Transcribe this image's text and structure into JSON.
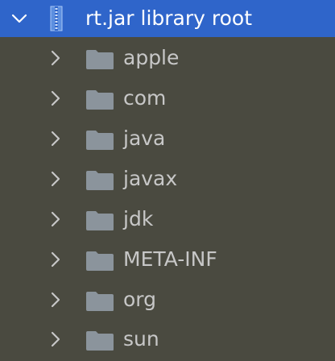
{
  "tree": {
    "root": {
      "label": "rt.jar  library root",
      "icon": "jar-archive-icon",
      "expanded": true
    },
    "children": [
      {
        "label": "apple",
        "icon": "folder-icon"
      },
      {
        "label": "com",
        "icon": "folder-icon"
      },
      {
        "label": "java",
        "icon": "folder-icon"
      },
      {
        "label": "javax",
        "icon": "folder-icon"
      },
      {
        "label": "jdk",
        "icon": "folder-icon"
      },
      {
        "label": "META-INF",
        "icon": "folder-icon"
      },
      {
        "label": "org",
        "icon": "folder-icon"
      },
      {
        "label": "sun",
        "icon": "folder-icon"
      }
    ]
  },
  "colors": {
    "background": "#4a4a40",
    "selection": "#2f65ca",
    "text": "#c7c7c7",
    "selected_text": "#ffffff",
    "folder": "#8b949c",
    "chevron": "#c7c7c7"
  }
}
